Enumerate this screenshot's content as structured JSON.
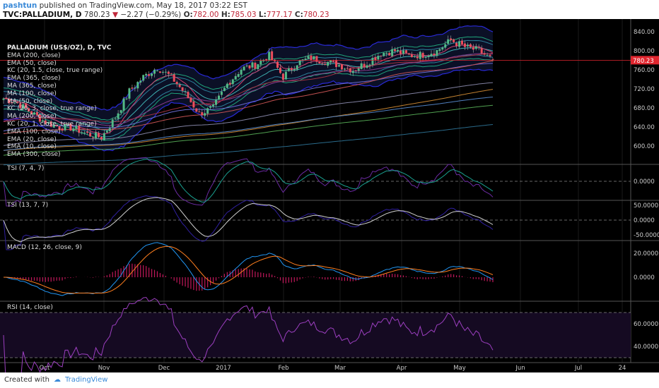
{
  "header": {
    "user": "pashtun",
    "published": "published on TradingView.com, May 18, 2017 03:22 EST",
    "symbol": "TVC:PALLADIUM, D",
    "last": "780.23",
    "change": "−2.27 (−0.29%)",
    "o_label": "O:",
    "o": "782.00",
    "h_label": "H:",
    "h": "785.03",
    "l_label": "L:",
    "l": "777.17",
    "c_label": "C:",
    "c": "780.23"
  },
  "legend": {
    "title": "PALLADIUM (US$/OZ), D, TVC",
    "items": [
      "EMA (200, close)",
      "EMA (50, close)",
      "KC (20, 1.5, close, true range)",
      "EMA (365, close)",
      "MA (365, close)",
      "MA (100, close)",
      "MA (50, close)",
      "KC (20, 3, close, true range)",
      "MA (200, close)",
      "KC (20, 1, close, true range)",
      "EMA (100, close)",
      "EMA (20, close)",
      "EMA (10, close)",
      "EMA (300, close)"
    ]
  },
  "panes": {
    "tsi1": "TSI (7, 4, 7)",
    "tsi2": "TSI (13, 7, 7)",
    "macd": "MACD (12, 26, close, 9)",
    "rsi": "RSI (14, close)"
  },
  "axes": {
    "price": [
      "840.00",
      "800.00",
      "760.00",
      "720.00",
      "680.00",
      "640.00",
      "600.00"
    ],
    "tsi1": [
      "0.0000"
    ],
    "tsi2": [
      "50.0000",
      "0.0000",
      "-50.0000"
    ],
    "macd": [
      "20.0000",
      "0.0000"
    ],
    "rsi": [
      "60.0000",
      "40.0000"
    ],
    "time": [
      "Oct",
      "Nov",
      "Dec",
      "2017",
      "Feb",
      "Mar",
      "Apr",
      "May",
      "Jun",
      "Jul",
      "24"
    ],
    "last_price_tag": "780.23"
  },
  "colors": {
    "up": "#53b987",
    "down": "#eb4d5c",
    "last_price": "#e0262f",
    "kc_outer": "#2a2ad8",
    "rsi": "#9c3fc0",
    "macd": "#2196f3",
    "signal": "#ff7f1f",
    "hist": "#c2185b"
  },
  "chart_data": {
    "type": "candlestick",
    "weekly_closes": [
      700,
      690,
      670,
      650,
      640,
      638,
      625,
      618,
      660,
      715,
      745,
      765,
      745,
      710,
      668,
      680,
      730,
      762,
      770,
      790,
      745,
      775,
      785,
      778,
      770,
      760,
      775,
      795,
      800,
      790,
      792,
      800,
      822,
      808,
      800,
      780.23
    ],
    "ylim": [
      580,
      860
    ]
  },
  "footer": {
    "created": "Created with",
    "brand": "TradingView"
  }
}
